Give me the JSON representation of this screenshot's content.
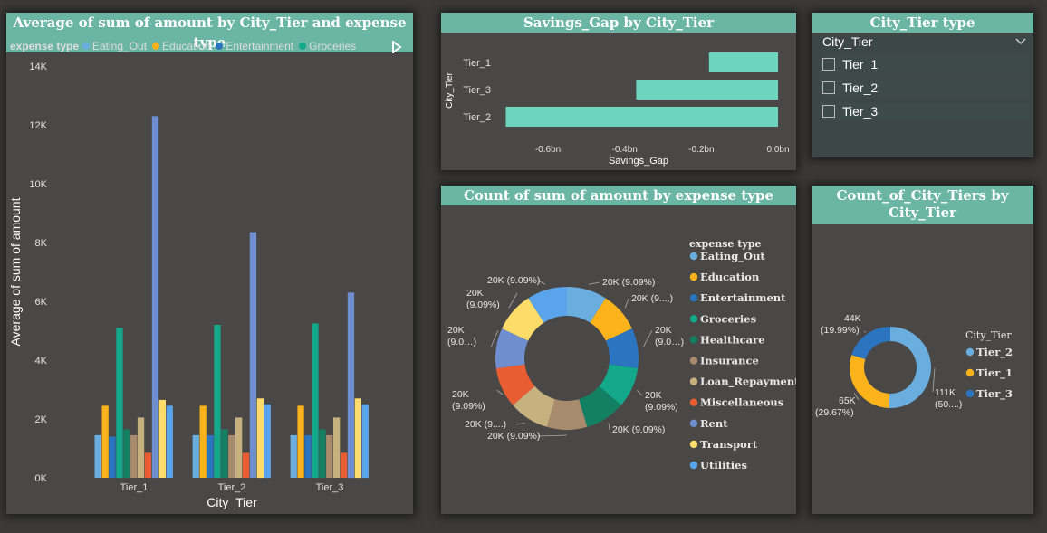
{
  "colors": {
    "Eating_Out": "#6aaee0",
    "Education": "#fbb31c",
    "Entertainment": "#2a74c0",
    "Groceries": "#13a88a",
    "Healthcare": "#138064",
    "Insurance": "#a88a6c",
    "Loan_Repayment": "#c6b17f",
    "Miscellaneous": "#e95d32",
    "Rent": "#6e8ed0",
    "Transport": "#fddc6a",
    "Utilities": "#5aa4ec"
  },
  "bar_panel": {
    "title": "Average of sum of amount by City_Tier and expense type",
    "legend_title": "expense type",
    "legend_items": [
      "Eating_Out",
      "Education",
      "Entertainment",
      "Groceries"
    ],
    "more_icon": "play-triangle-icon"
  },
  "savings_panel": {
    "title": "Savings_Gap by City_Tier"
  },
  "slicer_panel": {
    "title": "City_Tier type",
    "header": "City_Tier",
    "chevron_icon": "chevron-down-icon",
    "items": [
      "Tier_1",
      "Tier_2",
      "Tier_3"
    ]
  },
  "donut_panel": {
    "title": "Count of sum of amount by expense type"
  },
  "tier_count_panel": {
    "title": "Count_of_City_Tiers by City_Tier",
    "title_line1": "Count_of_City_Tiers by",
    "title_line2": "City_Tier"
  },
  "chart_data": [
    {
      "type": "bar",
      "title": "Average of sum of amount by City_Tier and expense type",
      "xlabel": "City_Tier",
      "ylabel": "Average of sum of amount",
      "ylim": [
        0,
        14000
      ],
      "yticks": [
        "0K",
        "2K",
        "4K",
        "6K",
        "8K",
        "10K",
        "12K",
        "14K"
      ],
      "categories": [
        "Tier_1",
        "Tier_2",
        "Tier_3"
      ],
      "legend_position": "top-left",
      "series": [
        {
          "name": "Eating_Out",
          "values": [
            1450,
            1450,
            1450
          ]
        },
        {
          "name": "Education",
          "values": [
            2450,
            2450,
            2450
          ]
        },
        {
          "name": "Entertainment",
          "values": [
            1400,
            1450,
            1450
          ]
        },
        {
          "name": "Groceries",
          "values": [
            5100,
            5200,
            5250
          ]
        },
        {
          "name": "Healthcare",
          "values": [
            1650,
            1650,
            1650
          ]
        },
        {
          "name": "Insurance",
          "values": [
            1450,
            1450,
            1450
          ]
        },
        {
          "name": "Loan_Repayment",
          "values": [
            2050,
            2050,
            2050
          ]
        },
        {
          "name": "Miscellaneous",
          "values": [
            850,
            850,
            850
          ]
        },
        {
          "name": "Rent",
          "values": [
            12300,
            8350,
            6300
          ]
        },
        {
          "name": "Transport",
          "values": [
            2650,
            2700,
            2700
          ]
        },
        {
          "name": "Utilities",
          "values": [
            2450,
            2500,
            2500
          ]
        }
      ]
    },
    {
      "type": "bar",
      "orientation": "horizontal",
      "title": "Savings_Gap by City_Tier",
      "xlabel": "Savings_Gap",
      "ylabel": "City_Tier",
      "categories": [
        "Tier_1",
        "Tier_3",
        "Tier_2"
      ],
      "values": [
        -0.18,
        -0.37,
        -0.71
      ],
      "xlim": [
        -0.73,
        0.0
      ],
      "xticks": [
        -0.6,
        -0.4,
        -0.2,
        0.0
      ],
      "xtick_labels": [
        "-0.6bn",
        "-0.4bn",
        "-0.2bn",
        "0.0bn"
      ],
      "bar_color": "#6dd4bf"
    },
    {
      "type": "pie",
      "donut": true,
      "title": "Count of sum of amount by expense type",
      "legend_title": "expense type",
      "legend_position": "right",
      "categories": [
        "Eating_Out",
        "Education",
        "Entertainment",
        "Groceries",
        "Healthcare",
        "Insurance",
        "Loan_Repayment",
        "Miscellaneous",
        "Rent",
        "Transport",
        "Utilities"
      ],
      "values": [
        20000,
        20000,
        20000,
        20000,
        20000,
        20000,
        20000,
        20000,
        20000,
        20000,
        20000
      ],
      "labels": [
        "20K (9.09%)",
        "20K (9....)",
        "20K (9.0…)",
        "20K (9.09%)",
        "20K (9.09%)",
        "20K (9.09%)",
        "20K (9....)",
        "20K (9.09%)",
        "20K (9.0…)",
        "20K (9.09%)",
        "20K (9.09%)"
      ]
    },
    {
      "type": "pie",
      "donut": true,
      "title": "Count_of_City_Tiers by City_Tier",
      "legend_title": "City_Tier",
      "legend_position": "right",
      "categories": [
        "Tier_2",
        "Tier_1",
        "Tier_3"
      ],
      "values": [
        111000,
        65000,
        44000
      ],
      "colors": [
        "#6aaee0",
        "#fbb31c",
        "#2a74c0"
      ],
      "labels": [
        "111K (50....)",
        "65K (29.67%)",
        "44K (19.99%)"
      ]
    }
  ]
}
